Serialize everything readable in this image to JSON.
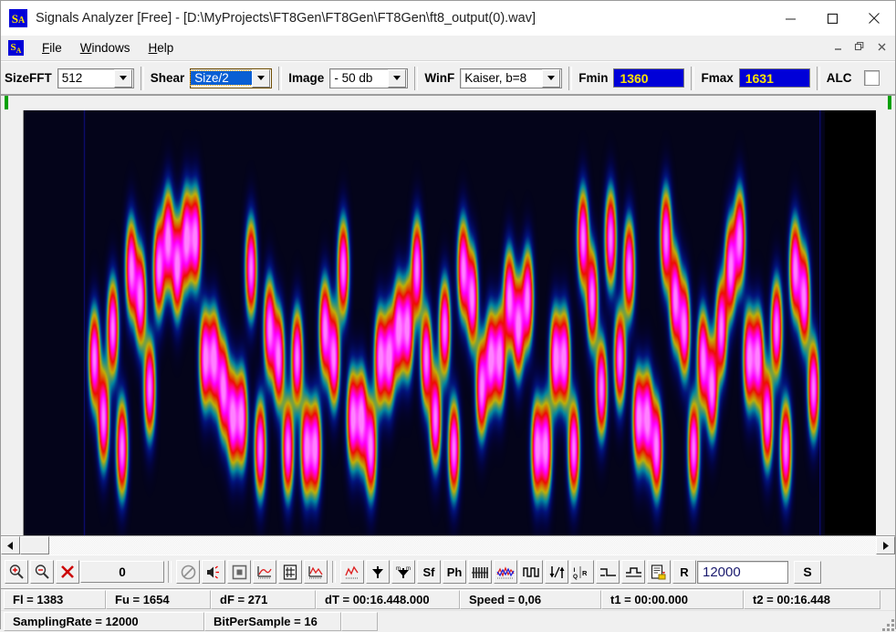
{
  "window": {
    "title": "Signals Analyzer [Free] - [D:\\MyProjects\\FT8Gen\\FT8Gen\\FT8Gen\\ft8_output(0).wav]",
    "app_icon": "signals-analyzer-icon",
    "icon_letters": {
      "first": "S",
      "second": "A"
    },
    "controls": {
      "minimize": "minimize-icon",
      "maximize": "maximize-icon",
      "close": "close-icon"
    }
  },
  "mdi": {
    "icon": "document-icon",
    "controls": {
      "minimize": "mdi-minimize-icon",
      "restore": "mdi-restore-icon",
      "close": "mdi-close-icon"
    }
  },
  "menu": {
    "items": [
      {
        "label": "File",
        "accel": "F"
      },
      {
        "label": "Windows",
        "accel": "W"
      },
      {
        "label": "Help",
        "accel": "H"
      }
    ]
  },
  "toolbar": {
    "sizefft": {
      "label": "SizeFFT",
      "value": "512"
    },
    "shear": {
      "label": "Shear",
      "value": "Size/2",
      "focused": true
    },
    "image": {
      "label": "Image",
      "value": "- 50 db"
    },
    "winf": {
      "label": "WinF",
      "value": "Kaiser, b=8"
    },
    "fmin": {
      "label": "Fmin",
      "value": "1360"
    },
    "fmax": {
      "label": "Fmax",
      "value": "1631"
    },
    "alc": {
      "label": "ALC",
      "checked": false
    }
  },
  "icon_toolbar": {
    "zoom_in": "zoom-in-icon",
    "zoom_out": "zoom-out-icon",
    "clear": "clear-x-icon",
    "counter_value": "0",
    "buttons": [
      {
        "name": "no-entry-icon",
        "glyph": ""
      },
      {
        "name": "speaker-icon",
        "glyph": ""
      },
      {
        "name": "square-select-icon",
        "glyph": ""
      },
      {
        "name": "envelope-plot-icon",
        "glyph": ""
      },
      {
        "name": "grid-page-icon",
        "glyph": ""
      },
      {
        "name": "signal-plot-icon",
        "glyph": ""
      },
      {
        "name": "red-trace-icon",
        "glyph": ""
      },
      {
        "name": "down-arrow-icon",
        "glyph": ""
      },
      {
        "name": "mwm-arrow-icon",
        "glyph": ""
      },
      {
        "name": "sf-icon",
        "glyph": "Sf"
      },
      {
        "name": "ph-icon",
        "glyph": "Ph"
      },
      {
        "name": "comb-icon",
        "glyph": ""
      },
      {
        "name": "waveform-icon",
        "glyph": ""
      },
      {
        "name": "pulse-icon",
        "glyph": ""
      },
      {
        "name": "updown-arrow-icon",
        "glyph": ""
      },
      {
        "name": "iqr-icon",
        "glyph": ""
      },
      {
        "name": "step-down-icon",
        "glyph": ""
      },
      {
        "name": "step-flat-icon",
        "glyph": ""
      },
      {
        "name": "save-doc-icon",
        "glyph": ""
      },
      {
        "name": "record-button",
        "glyph": "R"
      }
    ],
    "rate_value": "12000",
    "s_button": "S"
  },
  "status": {
    "row1": [
      "Fl = 1383",
      "Fu = 1654",
      "dF = 271",
      "dT = 00:16.448.000",
      "Speed = 0,06",
      "t1 = 00:00.000",
      "t2 = 00:16.448"
    ],
    "row2": [
      "SamplingRate = 12000",
      "BitPerSample = 16",
      ""
    ]
  },
  "spectrogram": {
    "name": "spectrogram-canvas",
    "description": "FT8 signal spectrogram, 8-FSK tone hopping",
    "colors": {
      "background": "#04041a",
      "low": "#0000ff",
      "mid_low": "#00e5ff",
      "mid": "#ffe800",
      "high": "#ff1000",
      "peak": "#ff00ff",
      "marker": "#00a000",
      "void": "#000000"
    },
    "markers": {
      "left": "start-marker",
      "right": "end-marker"
    }
  },
  "scrollbar": {
    "left_arrow": "scroll-left-icon",
    "right_arrow": "scroll-right-icon",
    "thumb": "scroll-thumb"
  }
}
